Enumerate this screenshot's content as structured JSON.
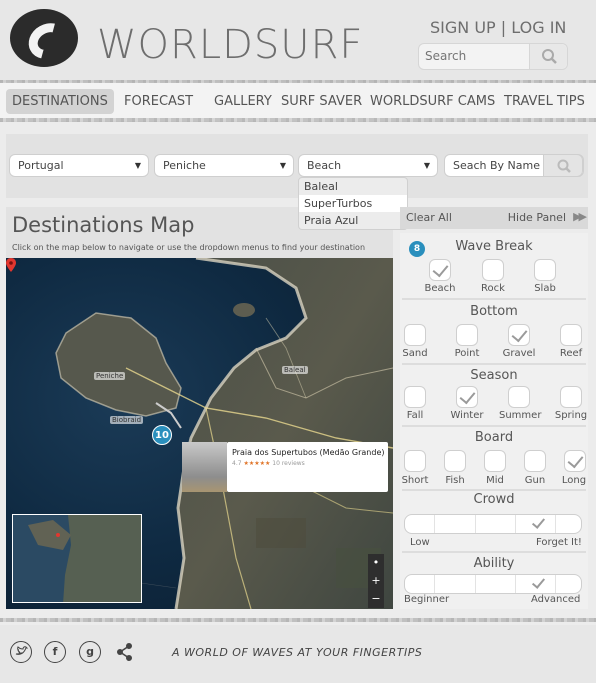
{
  "brand": {
    "name": "WORLDSURF"
  },
  "auth": {
    "signup": "SIGN UP",
    "separator": "|",
    "login": "LOG IN"
  },
  "search": {
    "placeholder": "Search"
  },
  "nav": {
    "items": [
      {
        "label": "DESTINATIONS",
        "active": true
      },
      {
        "label": "FORECAST"
      },
      {
        "label": "GALLERY"
      },
      {
        "label": "SURF SAVER"
      },
      {
        "label": "WORLDSURF CAMS"
      },
      {
        "label": "TRAVEL TIPS"
      }
    ]
  },
  "filters": {
    "country": "Portugal",
    "region": "Peniche",
    "spot_type": "Beach",
    "name_placeholder": "Seach By Name",
    "dropdown_options": [
      "Baleal",
      "SuperTurbos",
      "Praia Azul"
    ],
    "dropdown_highlighted": "SuperTurbos"
  },
  "map": {
    "title": "Destinations Map",
    "subtitle": "Click on the map below to navigate or use the dropdown menus to find your destination",
    "cluster_count": "10",
    "popup": {
      "title": "Praia dos Supertubos (Medão Grande)",
      "rating": "4.7",
      "stars": "★★★★★",
      "reviews": "10 reviews"
    },
    "place_labels": [
      "Peniche",
      "Baleal",
      "Biobraid"
    ],
    "zoom": {
      "in": "+",
      "out": "−",
      "center": "•"
    }
  },
  "panel": {
    "clear_label": "Clear All",
    "hide_label": "Hide Panel",
    "count": "8",
    "wave_break": {
      "title": "Wave Break",
      "options": [
        {
          "label": "Beach",
          "checked": true
        },
        {
          "label": "Rock",
          "checked": false
        },
        {
          "label": "Slab",
          "checked": false
        }
      ]
    },
    "bottom": {
      "title": "Bottom",
      "options": [
        {
          "label": "Sand",
          "checked": false
        },
        {
          "label": "Point",
          "checked": false
        },
        {
          "label": "Gravel",
          "checked": true
        },
        {
          "label": "Reef",
          "checked": false
        }
      ]
    },
    "season": {
      "title": "Season",
      "options": [
        {
          "label": "Fall",
          "checked": false
        },
        {
          "label": "Winter",
          "checked": true
        },
        {
          "label": "Summer",
          "checked": false
        },
        {
          "label": "Spring",
          "checked": false
        }
      ]
    },
    "board": {
      "title": "Board",
      "options": [
        {
          "label": "Short",
          "checked": false
        },
        {
          "label": "Fish",
          "checked": false
        },
        {
          "label": "Mid",
          "checked": false
        },
        {
          "label": "Gun",
          "checked": false
        },
        {
          "label": "Long",
          "checked": true
        }
      ]
    },
    "crowd": {
      "title": "Crowd",
      "min_label": "Low",
      "max_label": "Forget It!",
      "value": 0.75
    },
    "ability": {
      "title": "Ability",
      "min_label": "Beginner",
      "max_label": "Advanced",
      "value": 0.75
    }
  },
  "footer": {
    "tagline": "A WORLD OF WAVES AT YOUR FINGERTIPS",
    "social": [
      "twitter-icon",
      "facebook-icon",
      "googleplus-icon",
      "share-icon"
    ]
  }
}
